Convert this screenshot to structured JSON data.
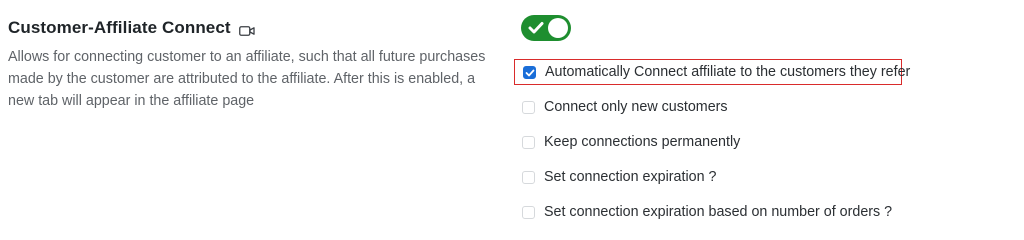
{
  "section": {
    "title": "Customer-Affiliate Connect",
    "title_icon": "video-camera-icon",
    "description": "Allows for connecting customer to an affiliate, such that all future purchases made by the customer are attributed to the affiliate. After this is enabled, a new tab will appear in the affiliate page"
  },
  "toggle": {
    "state": "on",
    "icon": "check-icon",
    "color": "#1e8e2f"
  },
  "options": [
    {
      "label": "Automatically Connect affiliate to the customers they refer",
      "checked": true,
      "highlighted": true
    },
    {
      "label": "Connect only new customers",
      "checked": false
    },
    {
      "label": "Keep connections permanently",
      "checked": false
    },
    {
      "label": "Set connection expiration ?",
      "checked": false
    },
    {
      "label": "Set connection expiration based on number of orders ?",
      "checked": false
    }
  ],
  "colors": {
    "highlight_border": "#d92b2b",
    "checkbox_checked": "#1a6ed8"
  }
}
